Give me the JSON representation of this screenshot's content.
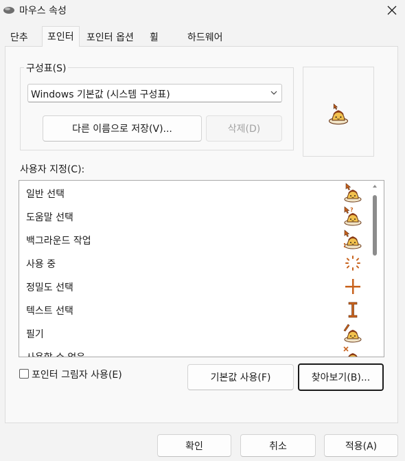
{
  "window": {
    "title": "마우스 속성",
    "icon": "mouse-icon",
    "close_icon": "close-icon"
  },
  "tabs": [
    {
      "label": "단추",
      "active": false
    },
    {
      "label": "포인터",
      "active": true
    },
    {
      "label": "포인터 옵션",
      "active": false
    },
    {
      "label": "휠",
      "active": false
    },
    {
      "label": "하드웨어",
      "active": false
    }
  ],
  "scheme": {
    "label": "구성표(S)",
    "selected": "Windows 기본값 (시스템 구성표)",
    "save_as_label": "다른 이름으로 저장(V)...",
    "delete_label": "삭제(D)"
  },
  "customize": {
    "label": "사용자 지정(C):",
    "items": [
      {
        "label": "일반 선택",
        "icon": "pudding-arrow-icon"
      },
      {
        "label": "도움말 선택",
        "icon": "pudding-help-icon"
      },
      {
        "label": "백그라운드 작업",
        "icon": "pudding-busy-icon"
      },
      {
        "label": "사용 중",
        "icon": "spinner-icon"
      },
      {
        "label": "정밀도 선택",
        "icon": "crosshair-icon"
      },
      {
        "label": "텍스트 선택",
        "icon": "ibeam-icon"
      },
      {
        "label": "필기",
        "icon": "pudding-pen-icon"
      },
      {
        "label": "사용할 수 없음",
        "icon": "pudding-unavailable-icon"
      }
    ]
  },
  "shadow": {
    "label": "포인터 그림자 사용(E)",
    "checked": false
  },
  "use_default_label": "기본값 사용(F)",
  "browse_label": "찾아보기(B)...",
  "footer": {
    "ok_label": "확인",
    "cancel_label": "취소",
    "apply_label": "적용(A)"
  },
  "colors": {
    "accent": "#1a1a1a",
    "pudding": "#f2c14e",
    "caramel": "#8a3a16",
    "cursor_orange": "#c8621c"
  }
}
